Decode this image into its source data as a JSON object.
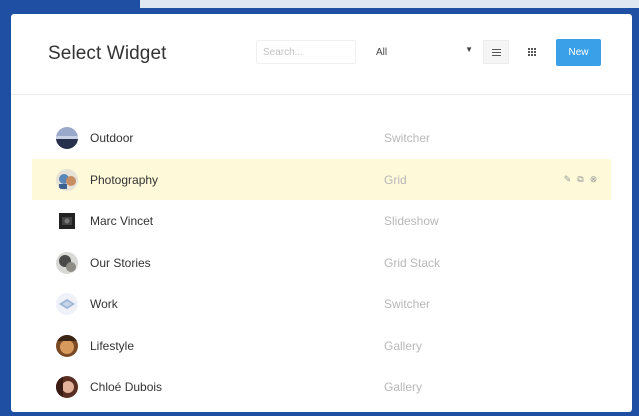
{
  "header": {
    "title": "Select Widget",
    "search_placeholder": "Search...",
    "filter_value": "All",
    "new_label": "New"
  },
  "widgets": [
    {
      "name": "Outdoor",
      "type": "Switcher",
      "avatar": "outdoor-thumbnail",
      "highlight": false
    },
    {
      "name": "Photography",
      "type": "Grid",
      "avatar": "photography-thumbnail",
      "highlight": true
    },
    {
      "name": "Marc Vincet",
      "type": "Slideshow",
      "avatar": "marc-vincet-thumbnail",
      "highlight": false
    },
    {
      "name": "Our Stories",
      "type": "Grid Stack",
      "avatar": "our-stories-thumbnail",
      "highlight": false
    },
    {
      "name": "Work",
      "type": "Switcher",
      "avatar": "work-thumbnail",
      "highlight": false
    },
    {
      "name": "Lifestyle",
      "type": "Gallery",
      "avatar": "lifestyle-thumbnail",
      "highlight": false
    },
    {
      "name": "Chloé Dubois",
      "type": "Gallery",
      "avatar": "chloe-dubois-thumbnail",
      "highlight": false
    }
  ],
  "row_actions": [
    "edit-icon",
    "copy-icon",
    "delete-icon"
  ],
  "colors": {
    "frame": "#1f4fa3",
    "accent": "#3aa0e8",
    "highlight_row": "#fdf9d9"
  }
}
